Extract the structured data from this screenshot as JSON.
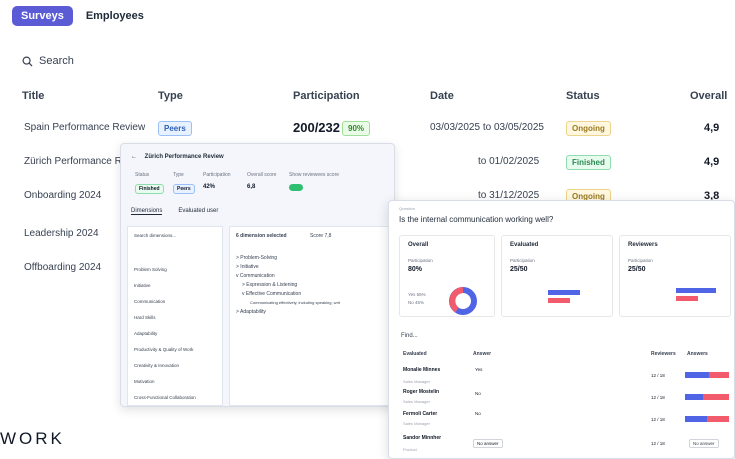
{
  "tabs": [
    "Surveys",
    "Employees"
  ],
  "search": {
    "placeholder": "Search"
  },
  "table": {
    "headers": [
      "Title",
      "Type",
      "Participation",
      "Date",
      "Status",
      "Overall"
    ],
    "rows": [
      {
        "title": "Spain Performance Review",
        "type": "Peers",
        "participation": "200/232",
        "pct": "90%",
        "date": "03/03/2025 to 03/05/2025",
        "status": "Ongoing",
        "overall": "4,9"
      },
      {
        "title": "Zürich Performance Re",
        "type": "",
        "participation": "",
        "pct": "",
        "date": "to 01/02/2025",
        "status": "Finished",
        "overall": "4,9"
      },
      {
        "title": "Onboarding 2024",
        "type": "",
        "participation": "",
        "pct": "",
        "date": "to 31/12/2025",
        "status": "Ongoing",
        "overall": "3,8"
      },
      {
        "title": "Leadership 2024",
        "type": "",
        "participation": "",
        "pct": "",
        "date": "",
        "status": "",
        "overall": ""
      },
      {
        "title": "Offboarding 2024",
        "type": "",
        "participation": "",
        "pct": "",
        "date": "",
        "status": "",
        "overall": ""
      }
    ]
  },
  "card1": {
    "title": "Zürich Performance Review",
    "meta_labels": [
      "Status",
      "Type",
      "Participation",
      "Overall score",
      "Show reviewees score"
    ],
    "status": "Finished",
    "type": "Peers",
    "participation": "42%",
    "overall_score": "6,8",
    "tabs": [
      "Dimensions",
      "Evaluated user"
    ],
    "search_placeholder": "Search dimensions...",
    "sidebar": [
      "Problem Solving",
      "Initiative",
      "Communication",
      "Hard Skills",
      "Adaptability",
      "Productivity & Quality of Work",
      "Creativity & Innovation",
      "Motivation",
      "Cross-Functional Collaboration"
    ],
    "selected_label": "6 dimension selected",
    "score": "Score 7,8",
    "tree": [
      "> Problem-Solving",
      "> Initiative",
      "v Communication",
      "> Expression & Listening",
      "v Effective Communication",
      "Communicating effectively, including speaking, writ",
      "> Adaptability"
    ]
  },
  "card2": {
    "small_label": "Question",
    "question": "Is the internal communication working well?",
    "boxes": [
      {
        "title": "Overall",
        "label": "Participation",
        "value": "80%",
        "legend": [
          "Yes 55%",
          "No 45%"
        ]
      },
      {
        "title": "Evaluated",
        "label": "Participation",
        "value": "25/50"
      },
      {
        "title": "Reviewers",
        "label": "Participation",
        "value": "25/50"
      }
    ],
    "search_placeholder": "Find...",
    "headers": [
      "Evaluated",
      "Answer",
      "Reviewers",
      "Answers"
    ],
    "rows": [
      {
        "name": "Monalie Minnes",
        "role": "Sales Manager",
        "answer": "Yes",
        "reviewers": "12 / 18"
      },
      {
        "name": "Roger Mostelin",
        "role": "Sales Manager",
        "answer": "No",
        "reviewers": "12 / 18"
      },
      {
        "name": "Fermoli Carter",
        "role": "Sales Manager",
        "answer": "No",
        "reviewers": "12 / 18"
      },
      {
        "name": "Sandor Minnher",
        "role": "Product",
        "answer": "No answer",
        "reviewers": "12 / 18"
      }
    ]
  },
  "footer_word": "WORK",
  "colors": {
    "accent": "#5b5bd6",
    "yes": "#5065e6",
    "no": "#f15b6c"
  }
}
